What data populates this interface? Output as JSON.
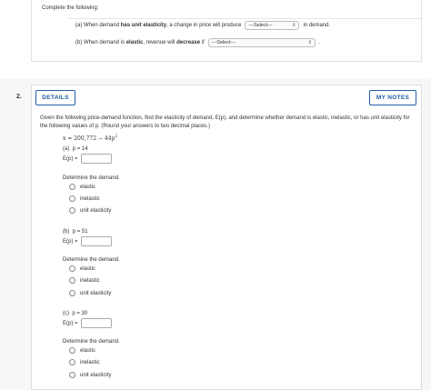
{
  "prev_question": {
    "title": "Complete the following:",
    "row_a": {
      "prefix": "(a) When demand ",
      "bold": "has unit elasticity",
      "middle": ", a change in price will produce",
      "select": "---Select---",
      "suffix": "in demand."
    },
    "row_b": {
      "prefix": "(b) When demand is ",
      "bold1": "elastic",
      "middle": ", revenue will ",
      "bold2": "decrease",
      "middle2": " if",
      "select": "---Select---",
      "suffix": "."
    }
  },
  "question": {
    "number": "2.",
    "details_label": "DETAILS",
    "notes_label": "MY NOTES",
    "prompt": "Given the following price-demand function, find the elasticity of demand, E(p), and determine whether demand is elastic, inelastic, or has unit elasticity for the following values of p. (Round your answers to two decimal places.)",
    "equation_base": "x = 200,772 − 44p",
    "equation_exp": "2",
    "ep_label": "E(p) =",
    "determine_label": "Determine the demand.",
    "options": [
      "elastic",
      "inelastic",
      "unit elasticity"
    ],
    "parts": [
      {
        "label": "(a)",
        "p_text": "p = 14"
      },
      {
        "label": "(b)",
        "p_text": "p = 51"
      },
      {
        "label": "(c)",
        "p_text": "p = 30"
      }
    ]
  },
  "icons": {
    "select_chevron": "chevron-up-down-icon",
    "radio": "radio-unchecked"
  }
}
